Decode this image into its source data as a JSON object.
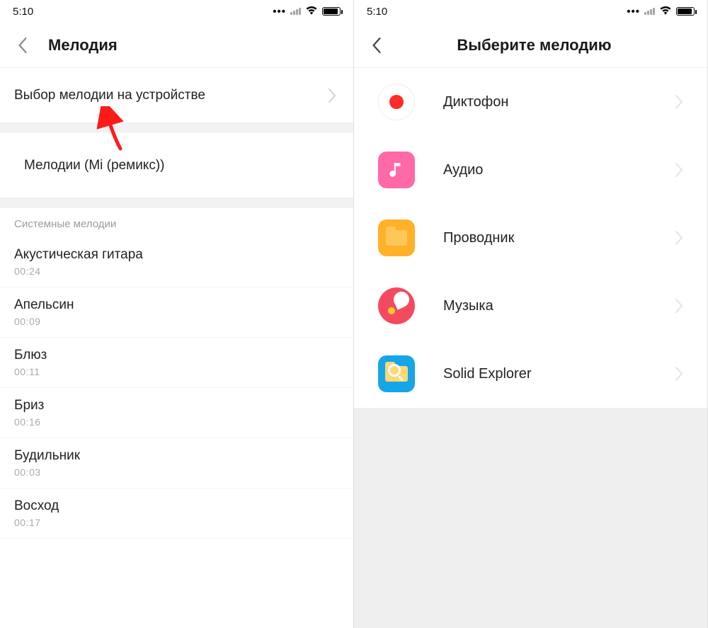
{
  "status": {
    "time": "5:10"
  },
  "left": {
    "title": "Мелодия",
    "pick_on_device": "Выбор мелодии на устройстве",
    "mi_remix": "Мелодии (Mi (ремикс))",
    "section": "Системные мелодии",
    "songs": [
      {
        "name": "Акустическая гитара",
        "dur": "00:24"
      },
      {
        "name": "Апельсин",
        "dur": "00:09"
      },
      {
        "name": "Блюз",
        "dur": "00:11"
      },
      {
        "name": "Бриз",
        "dur": "00:16"
      },
      {
        "name": "Будильник",
        "dur": "00:03"
      },
      {
        "name": "Восход",
        "dur": "00:17"
      }
    ]
  },
  "right": {
    "title": "Выберите мелодию",
    "apps": [
      {
        "id": "recorder",
        "label": "Диктофон"
      },
      {
        "id": "audio",
        "label": "Аудио"
      },
      {
        "id": "files",
        "label": "Проводник"
      },
      {
        "id": "music",
        "label": "Музыка"
      },
      {
        "id": "solid",
        "label": "Solid Explorer"
      }
    ]
  }
}
